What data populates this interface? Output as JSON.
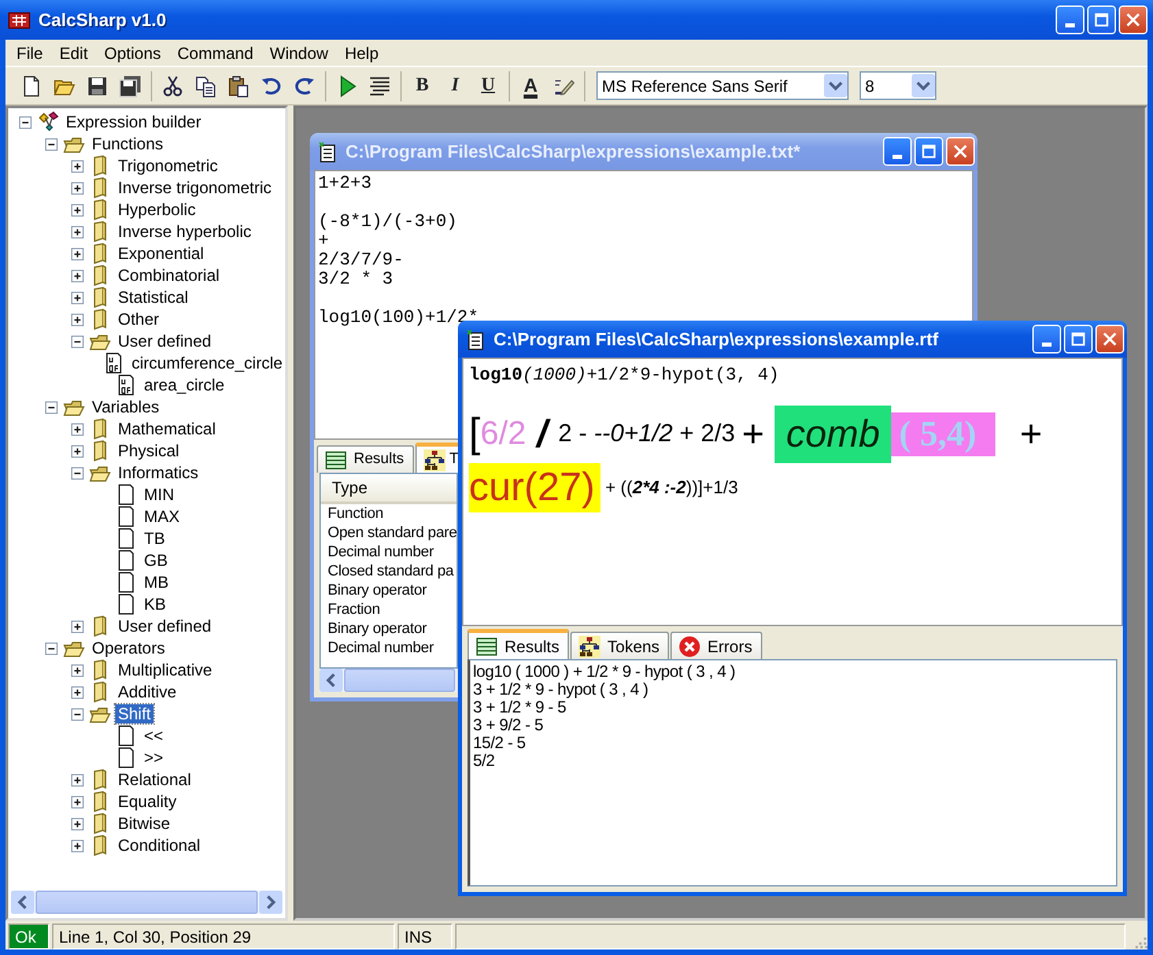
{
  "window": {
    "title": "CalcSharp v1.0"
  },
  "menu": [
    "File",
    "Edit",
    "Options",
    "Command",
    "Window",
    "Help"
  ],
  "toolbar": {
    "groups": [
      [
        {
          "kind": "new"
        },
        {
          "kind": "open"
        },
        {
          "kind": "save"
        },
        {
          "kind": "saveall"
        }
      ],
      [
        {
          "kind": "cut"
        },
        {
          "kind": "copy"
        },
        {
          "kind": "paste"
        },
        {
          "kind": "undo"
        },
        {
          "kind": "redo"
        }
      ],
      [
        {
          "kind": "run"
        },
        {
          "kind": "format"
        }
      ],
      [
        {
          "kind": "bold",
          "text": "B"
        },
        {
          "kind": "italic",
          "text": "I"
        },
        {
          "kind": "underline",
          "text": "U"
        }
      ],
      [
        {
          "kind": "color",
          "text": "A"
        },
        {
          "kind": "spell"
        }
      ]
    ],
    "font": "MS Reference Sans Serif",
    "size": "8"
  },
  "tree": [
    {
      "label": "Expression builder",
      "kind": "root",
      "expanded": true,
      "selected": false,
      "children": [
        {
          "label": "Functions",
          "kind": "folder",
          "expanded": true,
          "selected": false,
          "children": [
            {
              "label": "Trigonometric",
              "kind": "folder",
              "expanded": false,
              "selected": false
            },
            {
              "label": "Inverse trigonometric",
              "kind": "folder",
              "expanded": false,
              "selected": false
            },
            {
              "label": "Hyperbolic",
              "kind": "folder",
              "expanded": false,
              "selected": false
            },
            {
              "label": "Inverse hyperbolic",
              "kind": "folder",
              "expanded": false,
              "selected": false
            },
            {
              "label": "Exponential",
              "kind": "folder",
              "expanded": false,
              "selected": false
            },
            {
              "label": "Combinatorial",
              "kind": "folder",
              "expanded": false,
              "selected": false
            },
            {
              "label": "Statistical",
              "kind": "folder",
              "expanded": false,
              "selected": false
            },
            {
              "label": "Other",
              "kind": "folder",
              "expanded": false,
              "selected": false
            },
            {
              "label": "User defined",
              "kind": "folder",
              "expanded": true,
              "selected": false,
              "children": [
                {
                  "label": "circumference_circle",
                  "kind": "udf",
                  "selected": false
                },
                {
                  "label": "area_circle",
                  "kind": "udf",
                  "selected": false
                }
              ]
            }
          ]
        },
        {
          "label": "Variables",
          "kind": "folder",
          "expanded": true,
          "selected": false,
          "children": [
            {
              "label": "Mathematical",
              "kind": "folder",
              "expanded": false,
              "selected": false
            },
            {
              "label": "Physical",
              "kind": "folder",
              "expanded": false,
              "selected": false
            },
            {
              "label": "Informatics",
              "kind": "folder",
              "expanded": true,
              "selected": false,
              "children": [
                {
                  "label": "MIN",
                  "kind": "doc",
                  "selected": false
                },
                {
                  "label": "MAX",
                  "kind": "doc",
                  "selected": false
                },
                {
                  "label": "TB",
                  "kind": "doc",
                  "selected": false
                },
                {
                  "label": "GB",
                  "kind": "doc",
                  "selected": false
                },
                {
                  "label": "MB",
                  "kind": "doc",
                  "selected": false
                },
                {
                  "label": "KB",
                  "kind": "doc",
                  "selected": false
                }
              ]
            },
            {
              "label": "User defined",
              "kind": "folder",
              "expanded": false,
              "selected": false
            }
          ]
        },
        {
          "label": "Operators",
          "kind": "folder",
          "expanded": true,
          "selected": false,
          "children": [
            {
              "label": "Multiplicative",
              "kind": "folder",
              "expanded": false,
              "selected": false
            },
            {
              "label": "Additive",
              "kind": "folder",
              "expanded": false,
              "selected": false
            },
            {
              "label": "Shift",
              "kind": "folder",
              "expanded": true,
              "selected": true,
              "children": [
                {
                  "label": "<<",
                  "kind": "doc",
                  "selected": false
                },
                {
                  "label": ">>",
                  "kind": "doc",
                  "selected": false
                }
              ]
            },
            {
              "label": "Relational",
              "kind": "folder",
              "expanded": false,
              "selected": false
            },
            {
              "label": "Equality",
              "kind": "folder",
              "expanded": false,
              "selected": false
            },
            {
              "label": "Bitwise",
              "kind": "folder",
              "expanded": false,
              "selected": false
            },
            {
              "label": "Conditional",
              "kind": "folder",
              "expanded": false,
              "selected": false
            }
          ]
        }
      ]
    }
  ],
  "documents": [
    {
      "title": "C:\\Program Files\\CalcSharp\\expressions\\example.txt*",
      "active": false,
      "paragraphs": [
        [
          "1+2+3"
        ],
        [
          "(-8*1)/(-3+0)",
          "+",
          "2/3/7/9-",
          "3/2 * 3"
        ],
        [
          "log10(100)+1/2*"
        ]
      ],
      "tabs": [
        {
          "label": "Results",
          "selected": false
        },
        {
          "label": "T",
          "selected": true
        }
      ],
      "list": {
        "header": "Type",
        "rows": [
          "Function",
          "Open standard pare",
          "Decimal number",
          "Closed standard pa",
          "Binary operator",
          "Fraction",
          "Binary operator",
          "Decimal number"
        ]
      }
    },
    {
      "title": "C:\\Program Files\\CalcSharp\\expressions\\example.rtf",
      "active": true,
      "rich_lines": [
        [
          {
            "text": "log10",
            "kind": "bold"
          },
          {
            "text": "(1000)",
            "kind": "italic"
          },
          {
            "text": "+1/2*9-hypot(3, 4)",
            "kind": "mono"
          }
        ],
        [
          {
            "text": "[",
            "kind": "bracket"
          },
          {
            "text": "6/2",
            "kind": "pink"
          },
          {
            "text": " / ",
            "kind": "slash"
          },
          {
            "text": "2 - ",
            "kind": "plain"
          },
          {
            "text": "--0+1/2",
            "kind": "ital"
          },
          {
            "text": " + 2/3 ",
            "kind": "plain"
          },
          {
            "text": "+ ",
            "kind": "plus"
          },
          {
            "text": "comb",
            "kind": "comb"
          },
          {
            "text": "( 5,4)",
            "kind": "args"
          },
          {
            "text": " +",
            "kind": "plus"
          }
        ],
        [
          {
            "text": "cur(27)",
            "kind": "cur"
          },
          {
            "text": " + ((",
            "kind": "small"
          },
          {
            "text": "2*4 :-2",
            "kind": "smallbi"
          },
          {
            "text": "))]+1/3",
            "kind": "small"
          }
        ]
      ],
      "tabs": [
        {
          "label": "Results",
          "selected": true
        },
        {
          "label": "Tokens",
          "selected": false
        },
        {
          "label": "Errors",
          "selected": false
        }
      ],
      "results": [
        "log10 ( 1000 ) + 1/2 * 9 - hypot ( 3 , 4 )",
        "3 + 1/2 * 9 - hypot ( 3 , 4 )",
        "3 + 1/2 * 9 - 5",
        "3 + 9/2 - 5",
        "15/2 - 5",
        "5/2"
      ]
    }
  ],
  "status_bar": {
    "state": "Ok",
    "position": "Line 1, Col 30, Position 29",
    "mode": "INS"
  }
}
